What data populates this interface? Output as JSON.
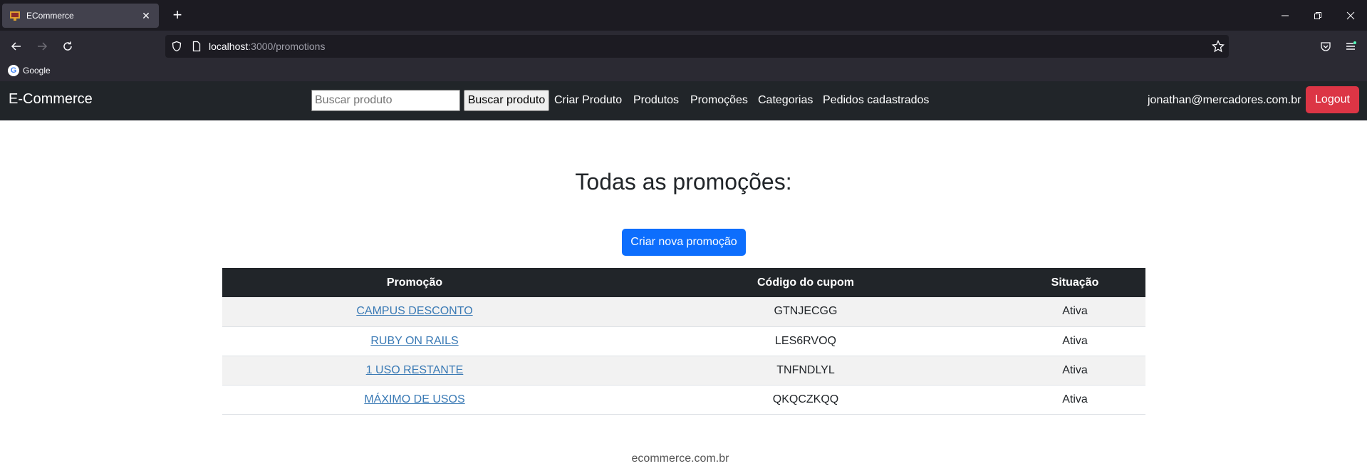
{
  "browser": {
    "tab_title": "ECommerce",
    "url_host": "localhost",
    "url_path": ":3000/promotions",
    "bookmarks": [
      {
        "label": "Google"
      }
    ]
  },
  "nav": {
    "brand": "E-Commerce",
    "search_placeholder": "Buscar produto",
    "search_button": "Buscar produto",
    "links": [
      "Criar Produto",
      "Produtos",
      "Promoções",
      "Categorias",
      "Pedidos cadastrados"
    ],
    "user_email": "jonathan@mercadores.com.br",
    "logout": "Logout"
  },
  "main": {
    "title": "Todas as promoções:",
    "create_button": "Criar nova promoção",
    "table": {
      "headers": [
        "Promoção",
        "Código do cupom",
        "Situação"
      ],
      "rows": [
        {
          "name": "CAMPUS DESCONTO",
          "code": "GTNJECGG",
          "status": "Ativa"
        },
        {
          "name": "RUBY ON RAILS",
          "code": "LES6RVOQ",
          "status": "Ativa"
        },
        {
          "name": "1 USO RESTANTE",
          "code": "TNFNDLYL",
          "status": "Ativa"
        },
        {
          "name": "MÁXIMO DE USOS",
          "code": "QKQCZKQQ",
          "status": "Ativa"
        }
      ]
    }
  },
  "footer": {
    "text": "ecommerce.com.br"
  },
  "colors": {
    "navbar": "#212529",
    "primary": "#0d6efd",
    "danger": "#dc3545"
  }
}
